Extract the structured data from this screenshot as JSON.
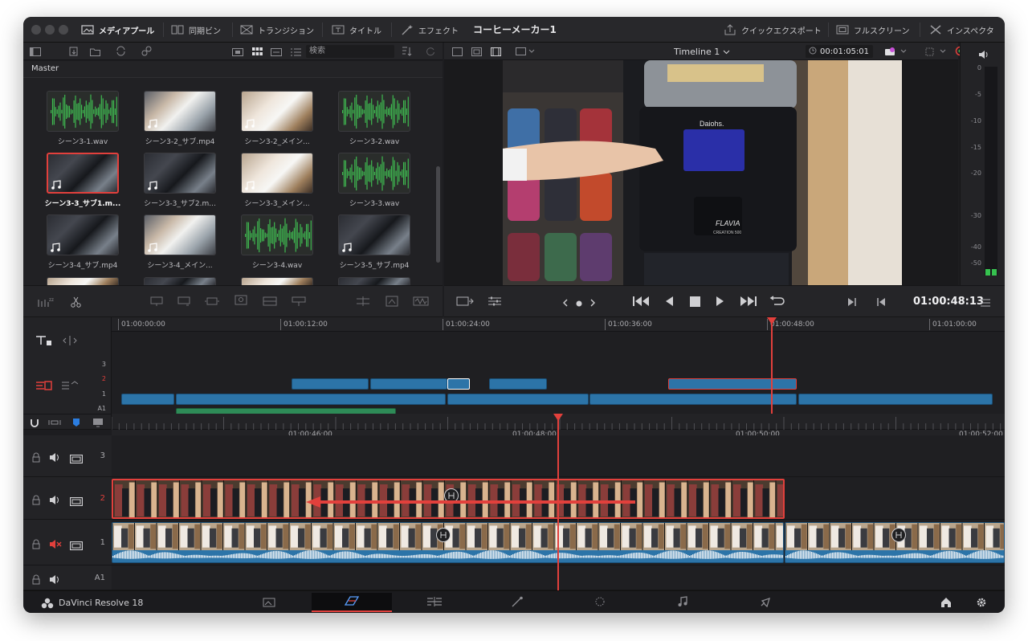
{
  "titlebar": {
    "items": [
      {
        "label": "メディアプール",
        "icon": "media-pool-icon",
        "active": true
      },
      {
        "label": "同期ビン",
        "icon": "sync-bin-icon"
      },
      {
        "label": "トランジション",
        "icon": "transitions-icon"
      },
      {
        "label": "タイトル",
        "icon": "titles-icon"
      },
      {
        "label": "エフェクト",
        "icon": "effects-icon"
      }
    ],
    "project_title": "コーヒーメーカー1",
    "right_items": [
      {
        "label": "クイックエクスポート",
        "icon": "quick-export-icon"
      },
      {
        "label": "フルスクリーン",
        "icon": "fullscreen-icon"
      },
      {
        "label": "インスペクタ",
        "icon": "inspector-icon"
      }
    ]
  },
  "media_pool": {
    "search_placeholder": "検索",
    "bin_name": "Master",
    "clips": [
      {
        "label": "シーン3-1.wav",
        "type": "audio"
      },
      {
        "label": "シーン3-2_サブ.mp4",
        "type": "video-a"
      },
      {
        "label": "シーン3-2_メイン...",
        "type": "video-c"
      },
      {
        "label": "シーン3-2.wav",
        "type": "audio"
      },
      {
        "label": "シーン3-3_サブ1.m...",
        "type": "video-b",
        "selected": true
      },
      {
        "label": "シーン3-3_サブ2.m...",
        "type": "video-b"
      },
      {
        "label": "シーン3-3_メイン...",
        "type": "video-c"
      },
      {
        "label": "シーン3-3.wav",
        "type": "audio"
      },
      {
        "label": "シーン3-4_サブ.mp4",
        "type": "video-b"
      },
      {
        "label": "シーン3-4_メイン...",
        "type": "video-a"
      },
      {
        "label": "シーン3-4.wav",
        "type": "audio"
      },
      {
        "label": "シーン3-5_サブ.mp4",
        "type": "video-b"
      }
    ]
  },
  "viewer": {
    "timeline_name": "Timeline 1",
    "duration": "00:01:05:01",
    "timecode": "01:00:48:13",
    "screen_brand": "Daiohs.",
    "machine_brand": "FLAVIA",
    "machine_model": "CREATION 500"
  },
  "audio_meter": {
    "scale": [
      "0",
      "-5",
      "-10",
      "-15",
      "-20",
      "-30",
      "-40",
      "-50"
    ]
  },
  "upper_timeline": {
    "ruler": [
      "01:00:00:00",
      "01:00:12:00",
      "01:00:24:00",
      "01:00:36:00",
      "01:00:48:00",
      "01:01:00:00"
    ],
    "tracks": [
      "3",
      "2",
      "1",
      "A1"
    ]
  },
  "lower_timeline": {
    "ruler": [
      "01:00:46:00",
      "01:00:48:00",
      "01:00:50:00",
      "01:00:52:00"
    ],
    "tracks": [
      "3",
      "2",
      "1",
      "A1"
    ]
  },
  "footer": {
    "app_name": "DaVinci Resolve 18",
    "pages": [
      "media-page-icon",
      "cut-page-icon",
      "edit-page-icon",
      "fusion-page-icon",
      "color-page-icon",
      "fairlight-page-icon",
      "deliver-page-icon"
    ],
    "active_page": 1
  },
  "colors": {
    "accent_red": "#e2403c",
    "clip_blue": "#2c74a8",
    "audio_green": "#2e8b57"
  }
}
